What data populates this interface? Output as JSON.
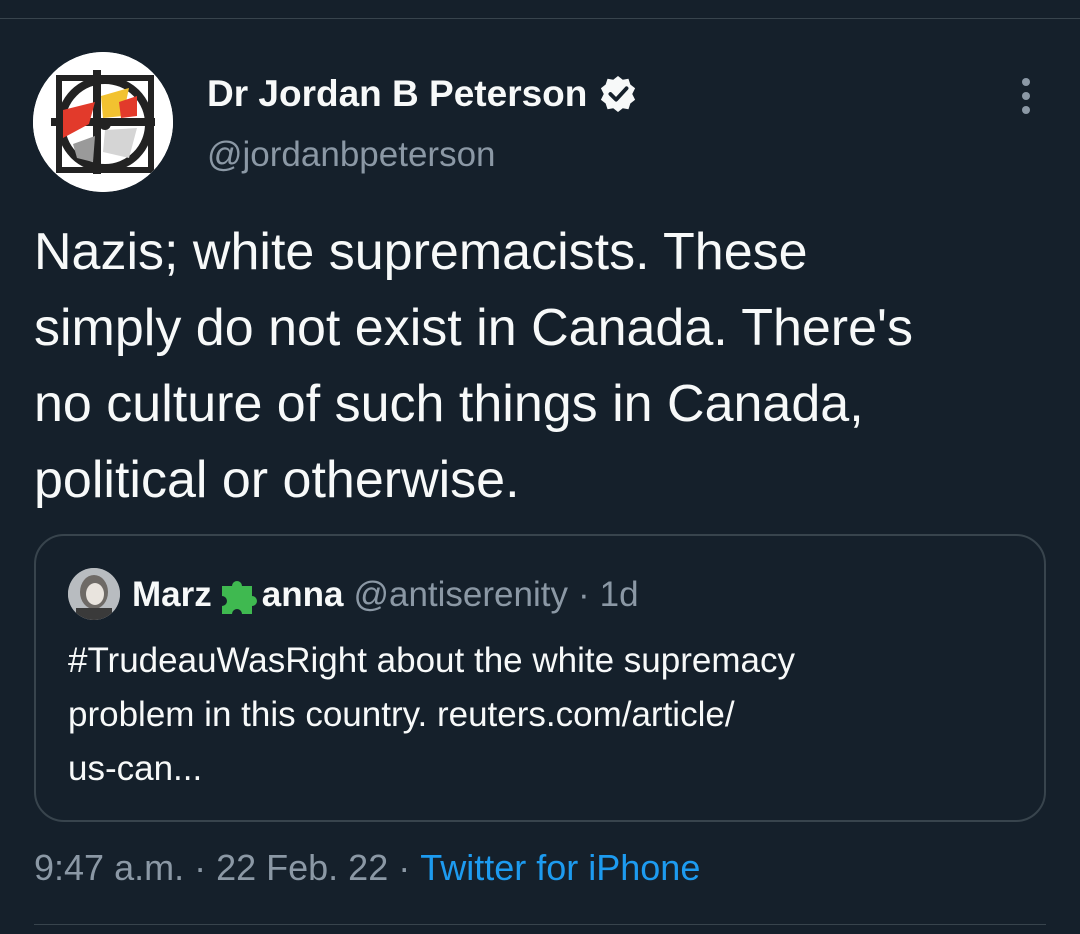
{
  "author": {
    "display_name": "Dr Jordan B Peterson",
    "handle": "@jordanbpeterson",
    "verified": true
  },
  "tweet": {
    "text_lines": [
      "Nazis; white supremacists. These",
      "simply do not exist in Canada. There's",
      "no culture of such things in Canada,",
      "political or otherwise."
    ]
  },
  "quoted_tweet": {
    "name_part1": "Marz",
    "name_emoji": "puzzle-piece-icon",
    "name_part2": "anna",
    "handle": "@antiserenity",
    "separator": "·",
    "time": "1d",
    "text_lines": [
      "#TrudeauWasRight about the white supremacy",
      "problem in this country.  reuters.com/article/",
      "us-can..."
    ]
  },
  "meta": {
    "time": "9:47 a.m.",
    "separator": "·",
    "date": "22 Feb. 22",
    "separator2": "·",
    "source": "Twitter for iPhone"
  },
  "colors": {
    "background": "#15202b",
    "text": "#f7f9f9",
    "secondary": "#8b98a5",
    "link": "#1d9bf0",
    "border": "#38444d",
    "puzzle": "#3fb950"
  }
}
